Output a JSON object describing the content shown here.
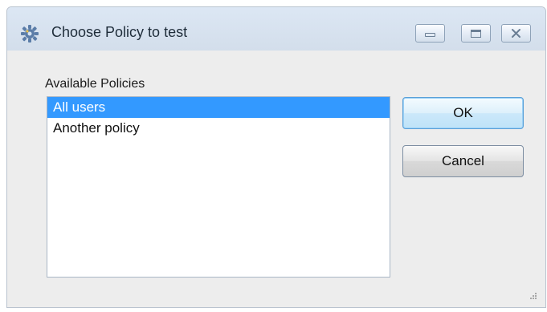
{
  "window": {
    "title": "Choose Policy to test",
    "icon": "gear-icon",
    "controls": {
      "minimize": "minimize-icon",
      "maximize": "maximize-icon",
      "close": "close-icon"
    }
  },
  "policies": {
    "label": "Available Policies",
    "items": [
      {
        "label": "All users",
        "selected": true
      },
      {
        "label": "Another policy",
        "selected": false
      }
    ]
  },
  "buttons": {
    "ok_label": "OK",
    "cancel_label": "Cancel"
  },
  "colors": {
    "selection": "#3399ff",
    "focus_border": "#5aa0d8",
    "title_text": "#1f2d3a"
  }
}
